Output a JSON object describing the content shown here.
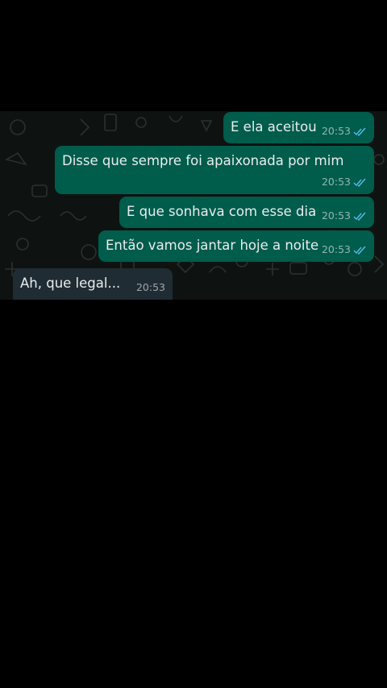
{
  "colors": {
    "background": "#000000",
    "chat_background": "#0e1311",
    "outgoing_bubble": "#005c4b",
    "incoming_bubble": "#202c33",
    "text": "#e9edef",
    "read_ticks": "#53bdeb"
  },
  "messages": [
    {
      "direction": "outgoing",
      "text": "E ela aceitou",
      "time": "20:53",
      "status_icon": "double-check-read-icon"
    },
    {
      "direction": "outgoing",
      "text": "Disse que sempre foi apaixonada por mim",
      "time": "20:53",
      "status_icon": "double-check-read-icon"
    },
    {
      "direction": "outgoing",
      "text": "E que sonhava com esse dia",
      "time": "20:53",
      "status_icon": "double-check-read-icon"
    },
    {
      "direction": "outgoing",
      "text": "Então vamos jantar hoje a noite",
      "time": "20:53",
      "status_icon": "double-check-read-icon"
    },
    {
      "direction": "incoming",
      "text": "Ah, que legal...",
      "time": "20:53"
    }
  ]
}
